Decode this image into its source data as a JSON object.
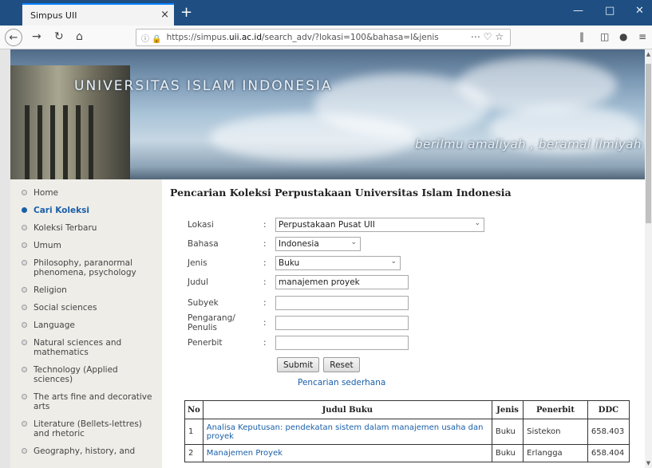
{
  "browser": {
    "tab_title": "Simpus UII",
    "tab_close": "×",
    "new_tab": "+",
    "url_prefix": "https://simpus.",
    "url_domain": "uii.ac.id",
    "url_rest": "/search_adv/?lokasi=100&bahasa=I&jenis",
    "url_icons": "⋯ ♡ ☆"
  },
  "banner": {
    "title": "UNIVERSITAS ISLAM INDONESIA",
    "motto": "berilmu amaliyah , beramal ilmiyah"
  },
  "sidebar": {
    "items": [
      {
        "label": "Home"
      },
      {
        "label": "Cari Koleksi"
      },
      {
        "label": "Koleksi Terbaru"
      },
      {
        "label": "Umum"
      },
      {
        "label": "Philosophy, paranormal phenomena, psychology"
      },
      {
        "label": "Religion"
      },
      {
        "label": "Social sciences"
      },
      {
        "label": "Language"
      },
      {
        "label": "Natural sciences and mathematics"
      },
      {
        "label": "Technology (Applied sciences)"
      },
      {
        "label": "The arts fine and decorative arts"
      },
      {
        "label": "Literature (Bellets-lettres) and rhetoric"
      },
      {
        "label": "Geography, history, and"
      }
    ]
  },
  "main": {
    "title": "Pencarian Koleksi Perpustakaan Universitas Islam Indonesia",
    "form": {
      "lokasi_label": "Lokasi",
      "lokasi_value": "Perpustakaan Pusat UII",
      "bahasa_label": "Bahasa",
      "bahasa_value": "Indonesia",
      "jenis_label": "Jenis",
      "jenis_value": "Buku",
      "judul_label": "Judul",
      "judul_value": "manajemen proyek",
      "subyek_label": "Subyek",
      "subyek_value": "",
      "pengarang_label": "Pengarang/ Penulis",
      "pengarang_value": "",
      "penerbit_label": "Penerbit",
      "penerbit_value": "",
      "colon": ":"
    },
    "submit_label": "Submit",
    "reset_label": "Reset",
    "simple_search_link": "Pencarian sederhana",
    "table": {
      "headers": [
        "No",
        "Judul Buku",
        "Jenis",
        "Penerbit",
        "DDC"
      ],
      "rows": [
        {
          "no": "1",
          "judul": "Analisa Keputusan: pendekatan sistem dalam manajemen usaha dan proyek",
          "jenis": "Buku",
          "penerbit": "Sistekon",
          "ddc": "658.403"
        },
        {
          "no": "2",
          "judul": "Manajemen Proyek",
          "jenis": "Buku",
          "penerbit": "Erlangga",
          "ddc": "658.404"
        }
      ]
    }
  }
}
